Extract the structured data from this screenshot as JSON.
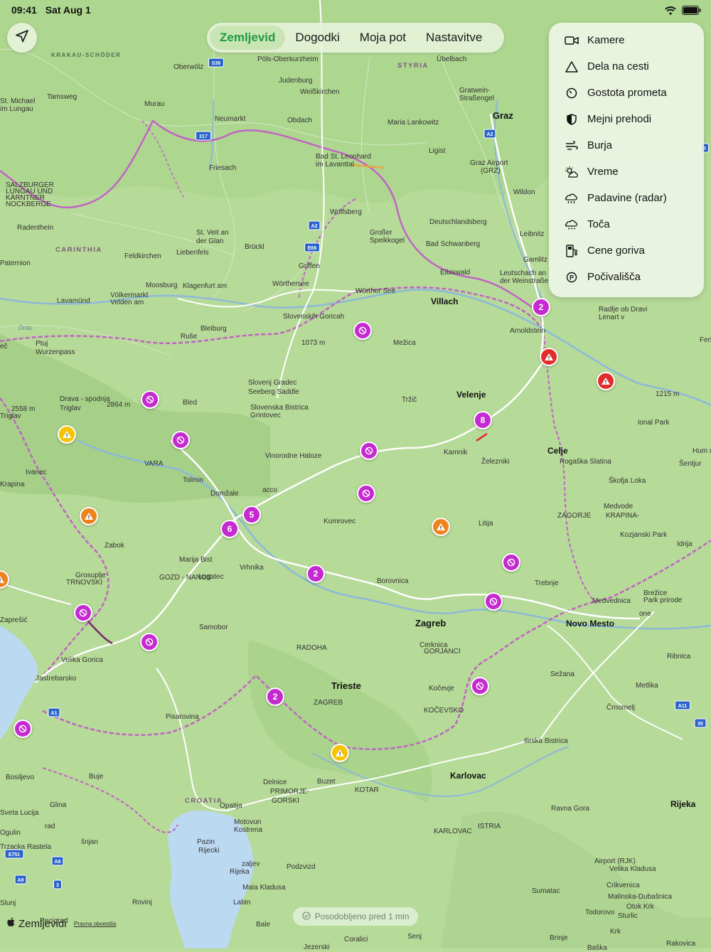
{
  "status": {
    "time": "09:41",
    "date": "Sat Aug 1"
  },
  "tabs": [
    {
      "label": "Zemljevid",
      "active": true
    },
    {
      "label": "Dogodki",
      "active": false
    },
    {
      "label": "Moja pot",
      "active": false
    },
    {
      "label": "Nastavitve",
      "active": false
    }
  ],
  "layers_menu": [
    {
      "label": "Kamere",
      "icon": "camera-icon"
    },
    {
      "label": "Dela na cesti",
      "icon": "warning-triangle-icon"
    },
    {
      "label": "Gostota prometa",
      "icon": "gauge-icon"
    },
    {
      "label": "Mejni prehodi",
      "icon": "shield-icon"
    },
    {
      "label": "Burja",
      "icon": "wind-icon"
    },
    {
      "label": "Vreme",
      "icon": "sun-cloud-icon"
    },
    {
      "label": "Padavine (radar)",
      "icon": "rain-cloud-icon"
    },
    {
      "label": "Toča",
      "icon": "hail-cloud-icon"
    },
    {
      "label": "Cene goriva",
      "icon": "fuel-icon"
    },
    {
      "label": "Počivališča",
      "icon": "parking-icon"
    }
  ],
  "footer": {
    "updated": "Posodobljeno pred 1 min",
    "brand": "Zemljevidi",
    "legal": "Pravna obvestila"
  },
  "map": {
    "places": [
      {
        "text": "KRAKAU-SCHÖDER",
        "cls": "region-green"
      },
      {
        "text": "Oberwölz"
      },
      {
        "text": "Pöls-Oberkurzheim"
      },
      {
        "text": "Übelbach"
      },
      {
        "text": "STYRIA",
        "cls": "region"
      },
      {
        "text": "St. Michael"
      },
      {
        "text": "im Lungau"
      },
      {
        "text": "Tamsweg"
      },
      {
        "text": "Murau"
      },
      {
        "text": "Judenburg"
      },
      {
        "text": "Weißkirchen"
      },
      {
        "text": "Gratwein-"
      },
      {
        "text": "Straßengel"
      },
      {
        "text": "Graz",
        "cls": "big"
      },
      {
        "text": "Neumarkt"
      },
      {
        "text": "Obdach"
      },
      {
        "text": "Maria Lankowitz"
      },
      {
        "text": "Graz Airport"
      },
      {
        "text": "(GRZ)"
      },
      {
        "text": "Ligist"
      },
      {
        "text": "Bad St. Leonhard"
      },
      {
        "text": "im Lavanttal"
      },
      {
        "text": "Friesach"
      },
      {
        "text": "SALZBURGER"
      },
      {
        "text": "LUNGAU UND"
      },
      {
        "text": "KÄRNTNER"
      },
      {
        "text": "NOCKBERGE"
      },
      {
        "text": "Wildon"
      },
      {
        "text": "Wolfsberg"
      },
      {
        "text": "Deutschlandsberg"
      },
      {
        "text": "Großer"
      },
      {
        "text": "Speikkogel"
      },
      {
        "text": "Radenthein"
      },
      {
        "text": "St. Veit an"
      },
      {
        "text": "der Glan"
      },
      {
        "text": "Leibnitz"
      },
      {
        "text": "Brückl"
      },
      {
        "text": "Bad Schwanberg"
      },
      {
        "text": "CARINTHIA",
        "cls": "region"
      },
      {
        "text": "Feldkirchen"
      },
      {
        "text": "Liebenfels"
      },
      {
        "text": "Gamlitz"
      },
      {
        "text": "Paternion"
      },
      {
        "text": "Griffen"
      },
      {
        "text": "Eibiswald"
      },
      {
        "text": "Leutschach an"
      },
      {
        "text": "der Weinstraße"
      },
      {
        "text": "Moosburg"
      },
      {
        "text": "Klagenfurt am"
      },
      {
        "text": "Wörthersee"
      },
      {
        "text": "Völkermarkt"
      },
      {
        "text": "Velden am"
      },
      {
        "text": "Wörther See"
      },
      {
        "text": "Lavamünd"
      },
      {
        "text": "Villach",
        "cls": "mid"
      },
      {
        "text": "Radlje ob Dravi"
      },
      {
        "text": "Lenart v"
      },
      {
        "text": "Slovenskih Goricah"
      },
      {
        "text": "Bleiburg"
      },
      {
        "text": "Drau",
        "cls": "water"
      },
      {
        "text": "Arnoldstein"
      },
      {
        "text": "Ruše"
      },
      {
        "text": "Ferlach"
      },
      {
        "text": "Ptuj"
      },
      {
        "text": "Wurzenpass"
      },
      {
        "text": "1073 m"
      },
      {
        "text": "Mežica"
      },
      {
        "text": "Slovenj Gradec"
      },
      {
        "text": "Seeberg Saddle"
      },
      {
        "text": "1215 m"
      },
      {
        "text": "Drava - spodnja"
      },
      {
        "text": "Triglav"
      },
      {
        "text": "2864 m"
      },
      {
        "text": "Bled"
      },
      {
        "text": "Tržič"
      },
      {
        "text": "Velenje",
        "cls": "mid"
      },
      {
        "text": "Slovenska Bistrica"
      },
      {
        "text": "Grintovec"
      },
      {
        "text": "2558 m"
      },
      {
        "text": "Triglav"
      },
      {
        "text": "ional Park"
      },
      {
        "text": "Vinorodne Haloze"
      },
      {
        "text": "Kamnik"
      },
      {
        "text": "Celje",
        "cls": "mid"
      },
      {
        "text": "Rogaška Slatina"
      },
      {
        "text": "Hum na Sutli"
      },
      {
        "text": "VARA"
      },
      {
        "text": "Železniki"
      },
      {
        "text": "Šentjur"
      },
      {
        "text": "Ivanec"
      },
      {
        "text": "Tolmin"
      },
      {
        "text": "Škofja Loka"
      },
      {
        "text": "Krapina"
      },
      {
        "text": "acco"
      },
      {
        "text": "Domžale"
      },
      {
        "text": "Medvode"
      },
      {
        "text": "KRAPINA-"
      },
      {
        "text": "ZAGORJE"
      },
      {
        "text": "Kumrovec"
      },
      {
        "text": "Litija"
      },
      {
        "text": "Kozjanski Park"
      },
      {
        "text": "Zabok"
      },
      {
        "text": "Idrija"
      },
      {
        "text": "Marija Bist"
      },
      {
        "text": "Vrhnika"
      },
      {
        "text": "Grosuplje"
      },
      {
        "text": "TRNOVSKI"
      },
      {
        "text": "GOZD - NANOS"
      },
      {
        "text": "Logatec"
      },
      {
        "text": "Borovnica"
      },
      {
        "text": "Trebnje"
      },
      {
        "text": "Brežice"
      },
      {
        "text": "Park prirode"
      },
      {
        "text": "Medvednica"
      },
      {
        "text": "Zaprešić"
      },
      {
        "text": "one"
      },
      {
        "text": "Zagreb",
        "cls": "big"
      },
      {
        "text": "Novo Mesto",
        "cls": "mid"
      },
      {
        "text": "Samobor"
      },
      {
        "text": "Cerknica"
      },
      {
        "text": "GORJANCI"
      },
      {
        "text": "RADOHA"
      },
      {
        "text": "Ribnica"
      },
      {
        "text": "Velika Gorica"
      },
      {
        "text": "Sežana"
      },
      {
        "text": "Jastrebarsko"
      },
      {
        "text": "Trieste",
        "cls": "big"
      },
      {
        "text": "Kočevje"
      },
      {
        "text": "Metlika"
      },
      {
        "text": "ZAGREB"
      },
      {
        "text": "KOČEVSKO"
      },
      {
        "text": "Črnomelj"
      },
      {
        "text": "Pisarovina"
      },
      {
        "text": "Ilirska Bistrica"
      },
      {
        "text": "Karlovac",
        "cls": "mid"
      },
      {
        "text": "Bosiljevo"
      },
      {
        "text": "Buje"
      },
      {
        "text": "Buzet"
      },
      {
        "text": "Delnice"
      },
      {
        "text": "PRIMORJE-"
      },
      {
        "text": "GORSKI"
      },
      {
        "text": "KOTAR"
      },
      {
        "text": "Ravna Gora"
      },
      {
        "text": "CROATIA",
        "cls": "region"
      },
      {
        "text": "Opatija"
      },
      {
        "text": "Rijeka",
        "cls": "mid"
      },
      {
        "text": "Glina"
      },
      {
        "text": "Motovun"
      },
      {
        "text": "Kostrena"
      },
      {
        "text": "Sveta Lucija"
      },
      {
        "text": "rad"
      },
      {
        "text": "ISTRIA"
      },
      {
        "text": "KARLOVAC"
      },
      {
        "text": "Ogulin"
      },
      {
        "text": "šnjan"
      },
      {
        "text": "Pazin"
      },
      {
        "text": "Rijecki"
      },
      {
        "text": "zaljev"
      },
      {
        "text": "Rijeka"
      },
      {
        "text": "Airport (RJK)"
      },
      {
        "text": "Velika Kladusa"
      },
      {
        "text": "Podzvizd"
      },
      {
        "text": "Crikvenica"
      },
      {
        "text": "Mala Kladusa"
      },
      {
        "text": "Malinska-Dubašnica"
      },
      {
        "text": "Sumatac"
      },
      {
        "text": "Slunj"
      },
      {
        "text": "Rovinj"
      },
      {
        "text": "Labin"
      },
      {
        "text": "Otok Krk"
      },
      {
        "text": "Todorovo"
      },
      {
        "text": "Sturlic"
      },
      {
        "text": "Pecigrad"
      },
      {
        "text": "Bale"
      },
      {
        "text": "Krk"
      },
      {
        "text": "Coralici"
      },
      {
        "text": "Senj"
      },
      {
        "text": "Brinje"
      },
      {
        "text": "Rakovica"
      },
      {
        "text": "Jezerski"
      },
      {
        "text": "Baška"
      },
      {
        "text": "Trzacka Rastela"
      },
      {
        "text": "eč"
      },
      {
        "text": "isio"
      }
    ],
    "markers": [
      {
        "kind": "purple",
        "text": "2"
      },
      {
        "kind": "purple",
        "text": ""
      },
      {
        "kind": "red",
        "text": ""
      },
      {
        "kind": "red",
        "text": ""
      },
      {
        "kind": "purple",
        "text": ""
      },
      {
        "kind": "purple",
        "text": ""
      },
      {
        "kind": "yellow",
        "text": ""
      },
      {
        "kind": "purple",
        "text": "8"
      },
      {
        "kind": "purple",
        "text": ""
      },
      {
        "kind": "purple",
        "text": ""
      },
      {
        "kind": "orange",
        "text": ""
      },
      {
        "kind": "purple",
        "text": "5"
      },
      {
        "kind": "purple",
        "text": "6"
      },
      {
        "kind": "orange",
        "text": ""
      },
      {
        "kind": "purple",
        "text": ""
      },
      {
        "kind": "purple",
        "text": "2"
      },
      {
        "kind": "purple",
        "text": ""
      },
      {
        "kind": "purple",
        "text": ""
      },
      {
        "kind": "purple",
        "text": ""
      },
      {
        "kind": "purple",
        "text": ""
      },
      {
        "kind": "purple",
        "text": "2"
      },
      {
        "kind": "yellow",
        "text": ""
      },
      {
        "kind": "purple",
        "text": ""
      },
      {
        "kind": "orange",
        "text": ""
      }
    ],
    "road_shields": [
      "S36",
      "317",
      "A2",
      "A2",
      "E66",
      "A1",
      "A11",
      "E751",
      "A8",
      "A9",
      "3",
      "30",
      "5"
    ]
  }
}
